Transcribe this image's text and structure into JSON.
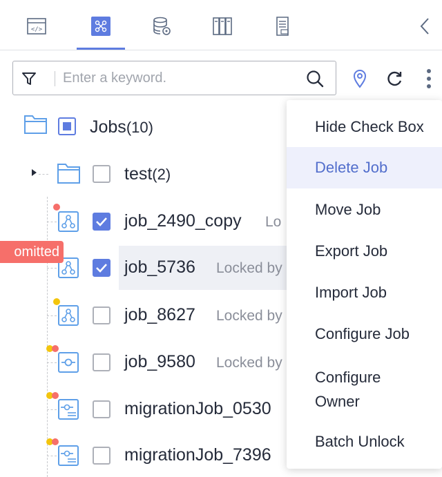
{
  "tabs": [
    {
      "name": "code-icon"
    },
    {
      "name": "job-flow-icon",
      "active": true
    },
    {
      "name": "database-icon"
    },
    {
      "name": "resource-icon"
    },
    {
      "name": "document-icon"
    }
  ],
  "search": {
    "placeholder": "Enter a keyword."
  },
  "tree": {
    "root": {
      "label": "Jobs",
      "count": "(10)"
    },
    "folder": {
      "label": "test",
      "count": "(2)"
    },
    "jobs": [
      {
        "name": "job_2490_copy",
        "lock": "Lo",
        "checked": true
      },
      {
        "name": "job_5736",
        "lock": "Locked by",
        "checked": true,
        "selected": true
      },
      {
        "name": "job_8627",
        "lock": "Locked by",
        "checked": false
      },
      {
        "name": "job_9580",
        "lock": "Locked by",
        "checked": false
      },
      {
        "name": "migrationJob_0530",
        "lock": "",
        "checked": false
      },
      {
        "name": "migrationJob_7396",
        "lock": "",
        "checked": false
      }
    ]
  },
  "status_tag": "omitted",
  "menu": {
    "items": [
      {
        "label": "Hide Check Box"
      },
      {
        "label": "Delete Job",
        "active": true
      },
      {
        "label": "Move Job"
      },
      {
        "label": "Export Job"
      },
      {
        "label": "Import Job"
      },
      {
        "label": "Configure Job"
      },
      {
        "label": "Configure\nOwner"
      },
      {
        "label": "Batch Unlock"
      }
    ]
  },
  "colors": {
    "accent": "#5e7ce0",
    "status_red": "#f66f6a",
    "status_orange": "#fa9841",
    "status_yellow": "#f3c50d"
  }
}
